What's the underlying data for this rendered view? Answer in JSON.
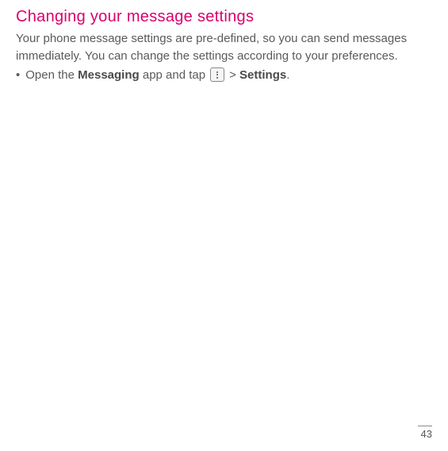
{
  "heading": "Changing your message settings",
  "body_line1": "Your phone message settings are pre-defined, so you can send messages",
  "body_line2": "immediately. You can change the settings according to your preferences.",
  "bullet": {
    "prefix": "Open the ",
    "app_name": "Messaging",
    "middle": " app and tap ",
    "gt": " > ",
    "settings": "Settings",
    "suffix": "."
  },
  "page_number": "43"
}
